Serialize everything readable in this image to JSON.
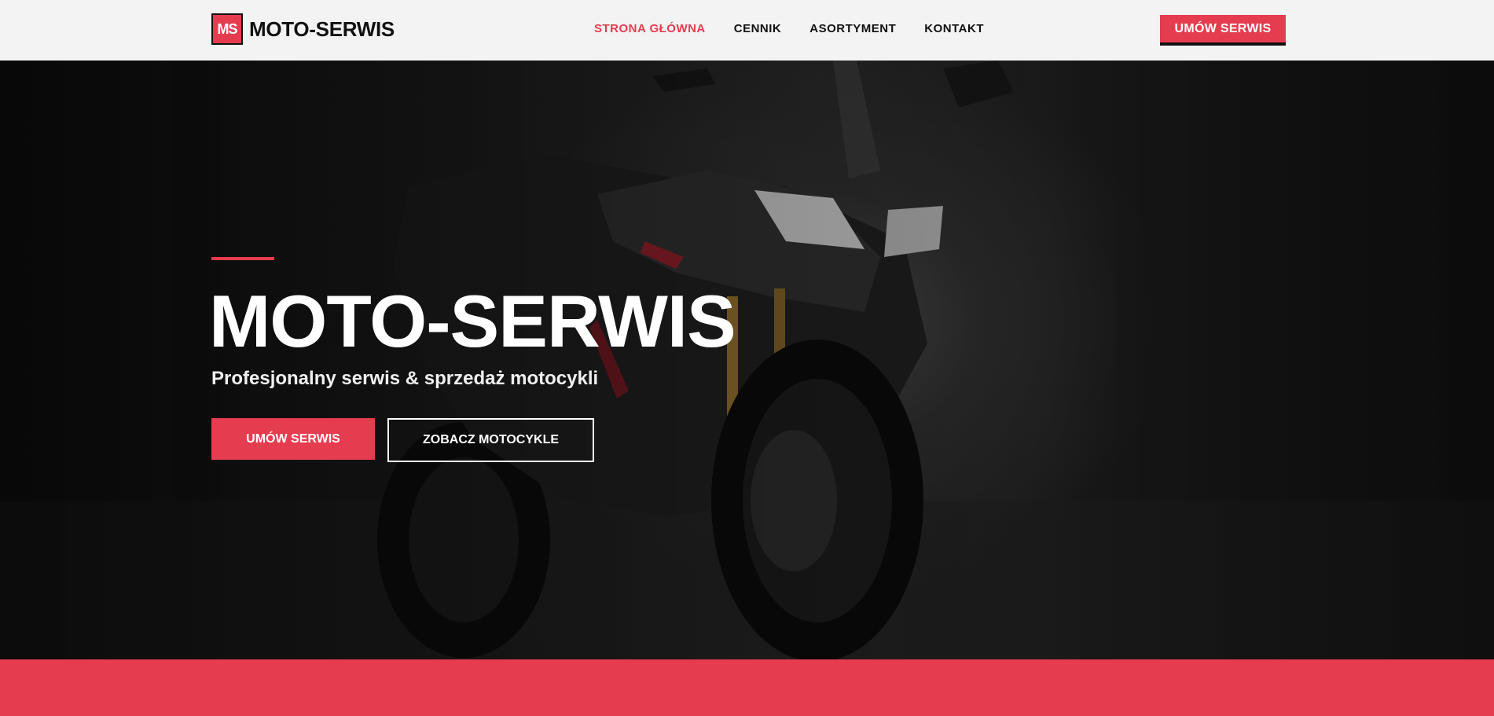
{
  "header": {
    "logo_mark": "MS",
    "logo_text": "MOTO-SERWIS",
    "nav": [
      {
        "label": "STRONA GŁÓWNA",
        "active": true
      },
      {
        "label": "CENNIK",
        "active": false
      },
      {
        "label": "ASORTYMENT",
        "active": false
      },
      {
        "label": "KONTAKT",
        "active": false
      }
    ],
    "cta_label": "UMÓW SERWIS"
  },
  "hero": {
    "title": "MOTO-SERWIS",
    "subtitle": "Profesjonalny serwis & sprzedaż motocykli",
    "primary_button": "UMÓW SERWIS",
    "secondary_button": "ZOBACZ MOTOCYKLE"
  },
  "colors": {
    "accent": "#e63c4f",
    "header_bg": "#f3f3f3",
    "dark": "#111111"
  }
}
